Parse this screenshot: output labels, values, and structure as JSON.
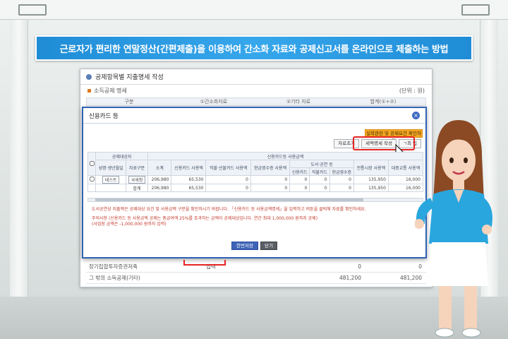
{
  "banner": {
    "title": "근로자가 편리한 연말정산(간편제출)을 이용하여 간소화 자료와 공제신고서를 온라인으로 제출하는 방법"
  },
  "page": {
    "title": "공제항목별 지출명세 작성",
    "subtitle": "소득공제 명세",
    "unit": "(단위 : 원)",
    "head": [
      "구분",
      "①간소화자료",
      "②기타 자료",
      "합계(①+②)"
    ],
    "rows": [
      {
        "label": "장기집합투자증권저축",
        "mid": "입력",
        "a": "0",
        "b": "0"
      },
      {
        "label": "그 밖의 소득공제(기타)",
        "mid": "",
        "a": "481,200",
        "b": "481,200"
      }
    ]
  },
  "modal": {
    "title": "신용카드 등",
    "orange_button": "실학관련 및 공제요건 확인하기",
    "buttons": {
      "reset": "자료초기",
      "detail": "세액명세 작성",
      "extra": "ㄱ최 입"
    },
    "columns": {
      "top": [
        "공제대상자",
        "신용카드등 사용금액"
      ],
      "sub": [
        "성명·생년월일",
        "자료구분",
        "소계",
        "신용카드 사용액",
        "직불·선불카드 사용액",
        "현금영수증 사용액",
        "도서·공연 등",
        "전통시장 사용액",
        "대중교통 사용액"
      ],
      "sub2": [
        "신용카드",
        "직불카드",
        "현금영수증"
      ]
    },
    "rows": [
      {
        "name": "테스트",
        "type": "국세청",
        "total": "206,980",
        "credit": "65,530",
        "debit": "0",
        "cash": "0",
        "c1": "0",
        "c2": "0",
        "c3": "0",
        "market": "135,950",
        "transit": "16,000"
      },
      {
        "name": "",
        "type": "합계",
        "total": "206,980",
        "credit": "65,530",
        "debit": "0",
        "cash": "0",
        "c1": "0",
        "c2": "0",
        "c3": "0",
        "market": "135,950",
        "transit": "16,000"
      }
    ],
    "note1": "도서공연상 지출액은 공제대상 요건 및 사용금액 구분을 확인하시기 바랍니다. 「신용카드 등 사용금액명세」을 입력하고 버튼을 클릭해 자료를 확인하세요.",
    "note2": "주의사항 (신용카드 등 사용금액 공제는 총급여액 25%를 초과하는 금액이 공제대상입니다. 연간 최대 1,000,000 원까지 공제)",
    "note3": "(사업장 금액은 -1,000,000 원까지 입력)",
    "submit": "한번저장",
    "close": "닫기"
  },
  "colors": {
    "banner": "#1f8cd6",
    "modal_border": "#2f63b4",
    "highlight": "#e52424",
    "orange": "#f6a623"
  }
}
